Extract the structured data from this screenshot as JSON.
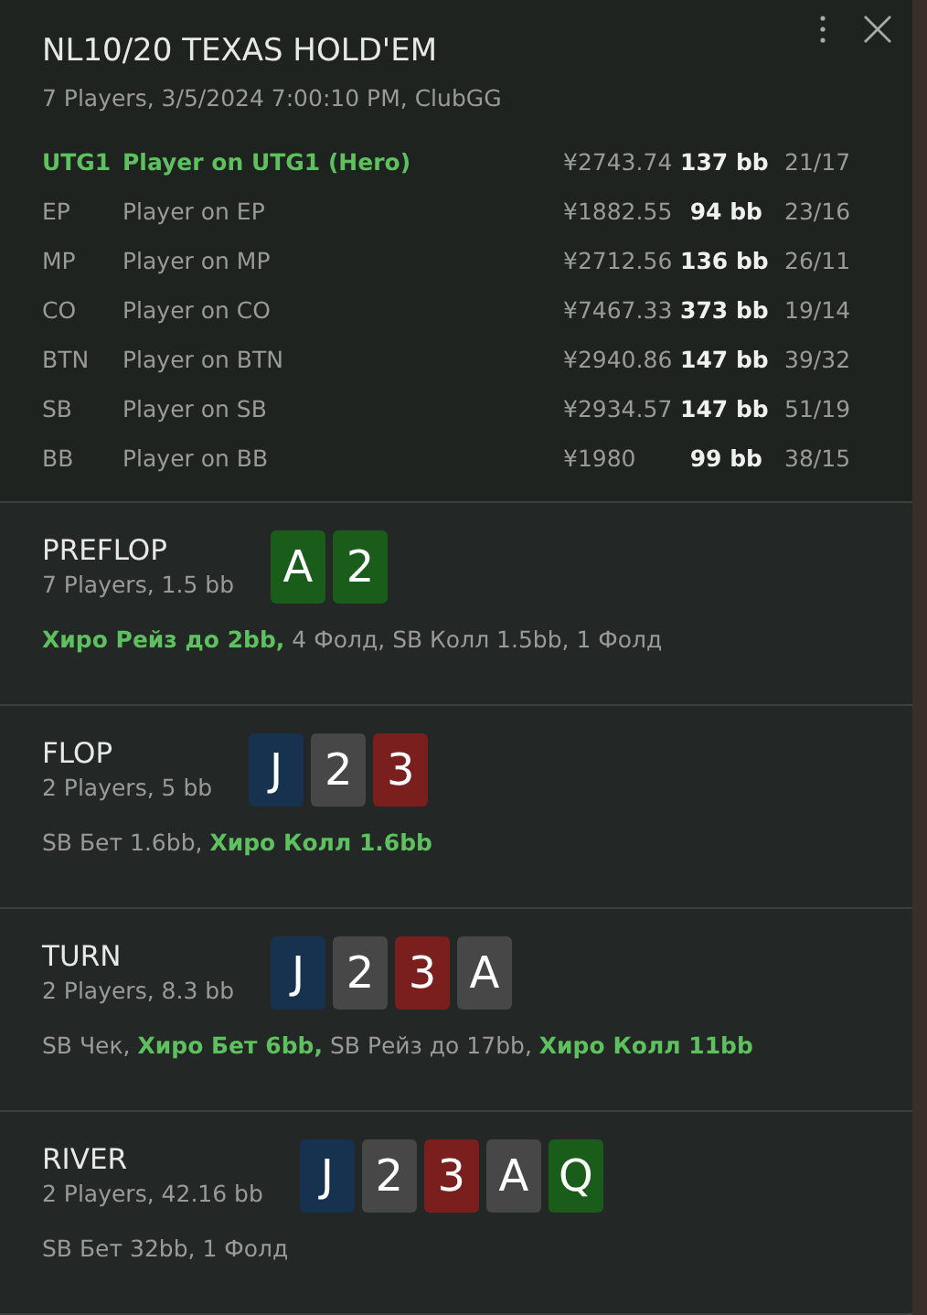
{
  "title": "NL10/20 TEXAS HOLD'EM",
  "subtitle": "7 Players, 3/5/2024 7:00:10 PM, ClubGG",
  "players": [
    {
      "position": "UTG1",
      "name": "Player on UTG1 (Hero)",
      "stack": "¥2743.74",
      "bb": "137 bb",
      "ratio": "21/17",
      "hero": true
    },
    {
      "position": "EP",
      "name": "Player on EP",
      "stack": "¥1882.55",
      "bb": "94 bb",
      "ratio": "23/16",
      "hero": false
    },
    {
      "position": "MP",
      "name": "Player on MP",
      "stack": "¥2712.56",
      "bb": "136 bb",
      "ratio": "26/11",
      "hero": false
    },
    {
      "position": "CO",
      "name": "Player on CO",
      "stack": "¥7467.33",
      "bb": "373 bb",
      "ratio": "19/14",
      "hero": false
    },
    {
      "position": "BTN",
      "name": "Player on BTN",
      "stack": "¥2940.86",
      "bb": "147 bb",
      "ratio": "39/32",
      "hero": false
    },
    {
      "position": "SB",
      "name": "Player on SB",
      "stack": "¥2934.57",
      "bb": "147 bb",
      "ratio": "51/19",
      "hero": false
    },
    {
      "position": "BB",
      "name": "Player on BB",
      "stack": "¥1980",
      "bb": "99 bb",
      "ratio": "38/15",
      "hero": false
    }
  ],
  "streets": [
    {
      "name": "PREFLOP",
      "info": "7 Players, 1.5 bb",
      "cards": [
        {
          "rank": "A",
          "color": "#1a5c1a"
        },
        {
          "rank": "2",
          "color": "#1a5c1a"
        }
      ],
      "actions": "**Хиро Рейз до 2bb,** 4 Фолд, SB Колл 1.5bb, 1 Фолд"
    },
    {
      "name": "FLOP",
      "info": "2 Players, 5 bb",
      "cards": [
        {
          "rank": "J",
          "color": "#16324f"
        },
        {
          "rank": "2",
          "color": "#474747"
        },
        {
          "rank": "3",
          "color": "#7a1e1e"
        }
      ],
      "actions": "SB Бет 1.6bb, **Хиро Колл 1.6bb**"
    },
    {
      "name": "TURN",
      "info": "2 Players, 8.3 bb",
      "cards": [
        {
          "rank": "J",
          "color": "#16324f"
        },
        {
          "rank": "2",
          "color": "#474747"
        },
        {
          "rank": "3",
          "color": "#7a1e1e"
        },
        {
          "rank": "A",
          "color": "#474747"
        }
      ],
      "actions": "SB Чек, **Хиро Бет 6bb,** SB Рейз до 17bb, **Хиро Колл 11bb**"
    },
    {
      "name": "RIVER",
      "info": "2 Players, 42.16 bb",
      "cards": [
        {
          "rank": "J",
          "color": "#16324f"
        },
        {
          "rank": "2",
          "color": "#474747"
        },
        {
          "rank": "3",
          "color": "#7a1e1e"
        },
        {
          "rank": "A",
          "color": "#474747"
        },
        {
          "rank": "Q",
          "color": "#1a5c1a"
        }
      ],
      "actions": "SB Бет 32bb, 1 Фолд"
    }
  ]
}
